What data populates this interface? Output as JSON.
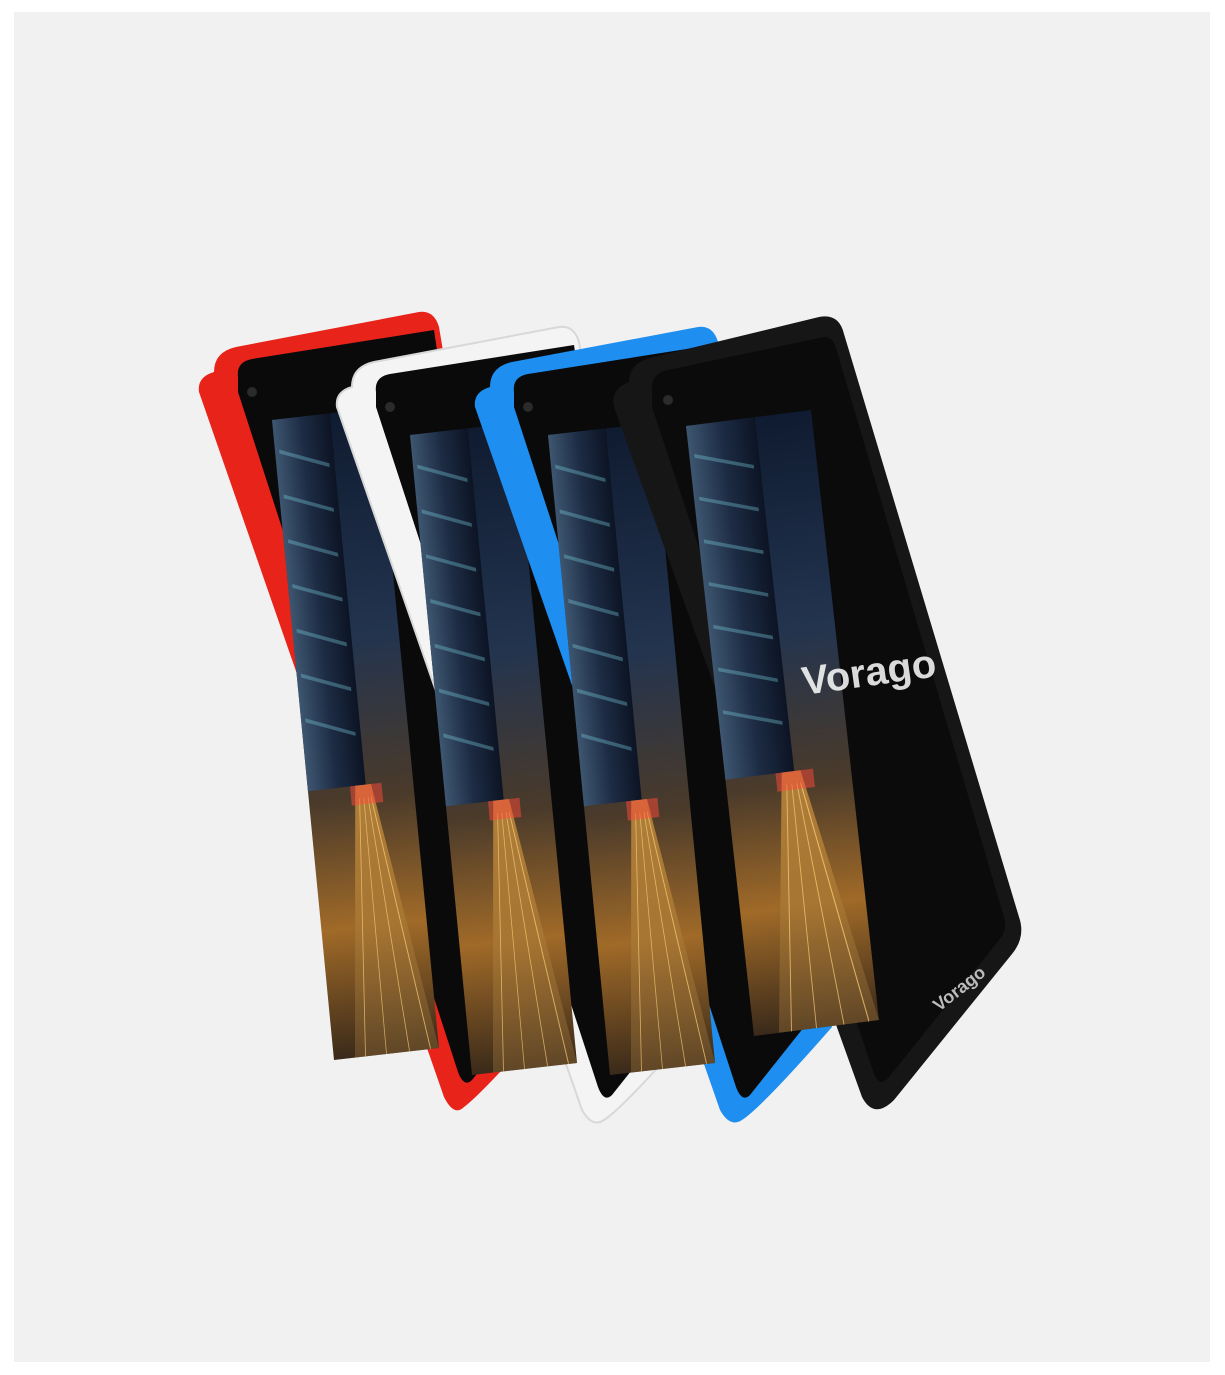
{
  "scene": {
    "background_color": "#f1f1f1",
    "page_color": "#ffffff",
    "brand_text": "Vorago",
    "tablets": [
      {
        "name": "red",
        "color": "#e8231a"
      },
      {
        "name": "white",
        "color": "#f4f4f4"
      },
      {
        "name": "blue",
        "color": "#1e8ef0"
      },
      {
        "name": "black",
        "color": "#161616"
      }
    ]
  }
}
